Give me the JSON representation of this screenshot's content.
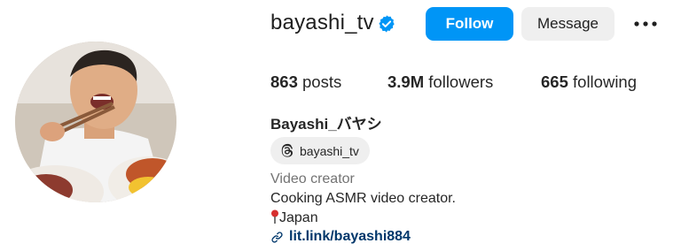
{
  "profile": {
    "username": "bayashi_tv",
    "verified": true,
    "follow_label": "Follow",
    "message_label": "Message",
    "more_icon": "more-options-icon",
    "stats": {
      "posts_count": "863",
      "posts_label": "posts",
      "followers_count": "3.9M",
      "followers_label": "followers",
      "following_count": "665",
      "following_label": "following"
    },
    "display_name": "Bayashi_バヤシ",
    "threads_handle": "bayashi_tv",
    "category": "Video creator",
    "bio": {
      "line1": "Cooking ASMR video creator.",
      "line2": "Japan"
    },
    "link": "lit.link/bayashi884"
  },
  "colors": {
    "accent": "#0095f6",
    "verified": "#0095f6",
    "link": "#00376b",
    "button_secondary": "#efefef"
  }
}
